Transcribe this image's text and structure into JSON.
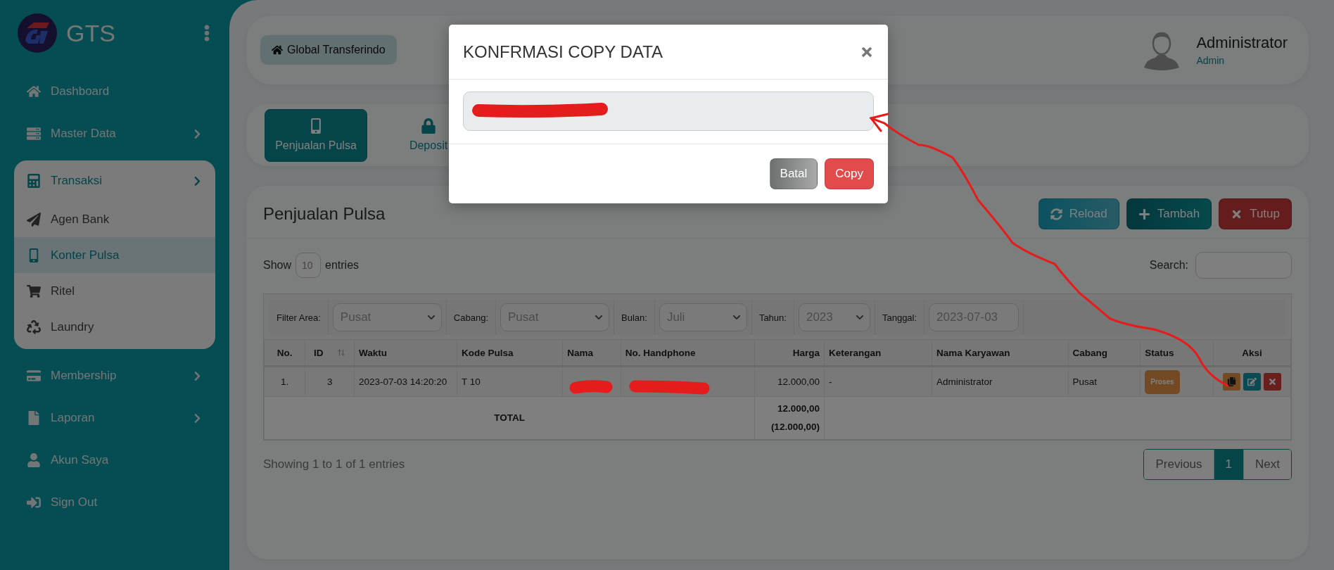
{
  "brand": {
    "name": "GTS"
  },
  "sidebar": {
    "items": [
      {
        "label": "Dashboard",
        "has_submenu": false,
        "selected": false
      },
      {
        "label": "Master Data",
        "has_submenu": true,
        "expanded": false,
        "selected": false
      },
      {
        "label": "Transaksi",
        "has_submenu": true,
        "expanded": true,
        "selected": true,
        "children": [
          {
            "label": "Agen Bank",
            "selected": false
          },
          {
            "label": "Konter Pulsa",
            "selected": true
          },
          {
            "label": "Ritel",
            "selected": false
          },
          {
            "label": "Laundry",
            "selected": false
          }
        ]
      },
      {
        "label": "Membership",
        "has_submenu": true,
        "expanded": false,
        "selected": false
      },
      {
        "label": "Laporan",
        "has_submenu": true,
        "expanded": false,
        "selected": false
      },
      {
        "label": "Akun Saya",
        "has_submenu": false,
        "selected": false
      },
      {
        "label": "Sign Out",
        "has_submenu": false,
        "selected": false
      }
    ]
  },
  "header": {
    "breadcrumb": "Global Transferindo",
    "user": {
      "name": "Administrator",
      "role": "Admin"
    }
  },
  "tabs": [
    {
      "label": "Penjualan Pulsa",
      "selected": true
    },
    {
      "label": "Deposit",
      "selected": false
    }
  ],
  "content": {
    "title": "Penjualan Pulsa",
    "buttons": [
      {
        "label": "Reload",
        "kind": "reload"
      },
      {
        "label": "Tambah",
        "kind": "add"
      },
      {
        "label": "Tutup",
        "kind": "close"
      }
    ],
    "length": {
      "prefix": "Show",
      "value": "10",
      "suffix": "entries"
    },
    "search": {
      "label": "Search:"
    },
    "filters": [
      {
        "label": "Filter Area:",
        "value": "Pusat",
        "kind": "select"
      },
      {
        "label": "Cabang:",
        "value": "Pusat",
        "kind": "select"
      },
      {
        "label": "Bulan:",
        "value": "Juli",
        "kind": "select"
      },
      {
        "label": "Tahun:",
        "value": "2023",
        "kind": "select"
      },
      {
        "label": "Tanggal:",
        "value": "2023-07-03",
        "kind": "date"
      }
    ],
    "table": {
      "columns": [
        {
          "label": "No.",
          "sortable": false
        },
        {
          "label": "ID",
          "sortable": true
        },
        {
          "label": "Waktu",
          "sortable": false
        },
        {
          "label": "Kode Pulsa",
          "sortable": false
        },
        {
          "label": "Nama",
          "sortable": false
        },
        {
          "label": "No. Handphone",
          "sortable": false
        },
        {
          "label": "Harga",
          "sortable": false
        },
        {
          "label": "Keterangan",
          "sortable": false
        },
        {
          "label": "Nama Karyawan",
          "sortable": false
        },
        {
          "label": "Cabang",
          "sortable": false
        },
        {
          "label": "Status",
          "sortable": false
        },
        {
          "label": "Aksi",
          "sortable": false
        }
      ],
      "rows": [
        {
          "no": "1.",
          "id": "3",
          "waktu": "2023-07-03 14:20:20",
          "kode": "T 10",
          "harga": "12.000,00",
          "keterangan": "-",
          "karyawan": "Administrator",
          "cabang": "Pusat",
          "status": {
            "label": "Proses"
          }
        }
      ],
      "total": {
        "label": "TOTAL",
        "values": [
          "12.000,00",
          "(12.000,00)"
        ]
      }
    },
    "info": "Showing 1 to 1 of 1 entries",
    "pagination": {
      "previous": "Previous",
      "pages": [
        {
          "label": "1",
          "selected": true
        }
      ],
      "next": "Next"
    }
  },
  "modal": {
    "title": "KONFRMASI COPY DATA",
    "buttons": [
      {
        "label": "Batal",
        "kind": "cancel"
      },
      {
        "label": "Copy",
        "kind": "confirm"
      }
    ]
  }
}
